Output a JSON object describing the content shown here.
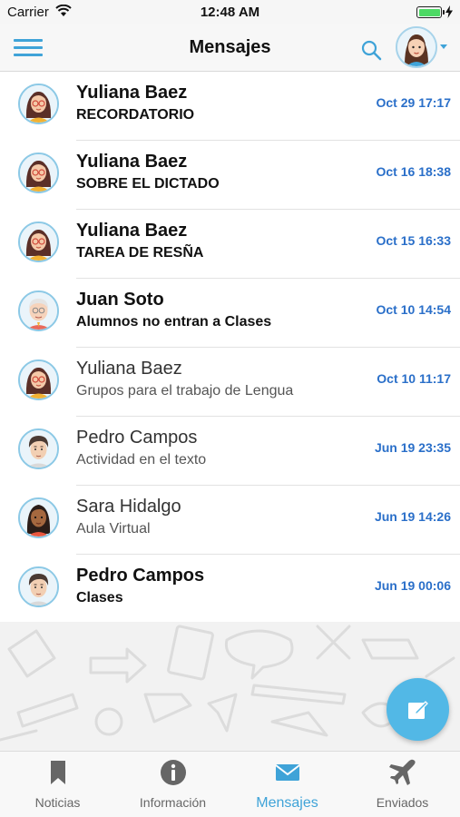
{
  "status_bar": {
    "carrier": "Carrier",
    "time": "12:48 AM"
  },
  "navbar": {
    "title": "Mensajes",
    "menu_icon": "hamburger-menu-icon",
    "search_icon": "search-icon"
  },
  "messages": [
    {
      "sender": "Yuliana Baez",
      "subject": "RECORDATORIO",
      "date": "Oct 29 17:17",
      "unread": true,
      "avatar": "female-teacher-glasses"
    },
    {
      "sender": "Yuliana Baez",
      "subject": "SOBRE EL DICTADO",
      "date": "Oct 16 18:38",
      "unread": true,
      "avatar": "female-teacher-glasses"
    },
    {
      "sender": "Yuliana Baez",
      "subject": "TAREA DE RESÑA",
      "date": "Oct 15 16:33",
      "unread": true,
      "avatar": "female-teacher-glasses"
    },
    {
      "sender": "Juan Soto",
      "subject": "Alumnos no entran a Clases",
      "date": "Oct 10 14:54",
      "unread": true,
      "avatar": "elderly-man"
    },
    {
      "sender": "Yuliana Baez",
      "subject": "Grupos para el trabajo de Lengua",
      "date": "Oct 10 11:17",
      "unread": false,
      "avatar": "female-teacher-glasses"
    },
    {
      "sender": "Pedro Campos",
      "subject": "Actividad en el texto",
      "date": "Jun 19 23:35",
      "unread": false,
      "avatar": "young-man"
    },
    {
      "sender": "Sara Hidalgo",
      "subject": "Aula Virtual",
      "date": "Jun 19 14:26",
      "unread": false,
      "avatar": "dark-skin-woman"
    },
    {
      "sender": "Pedro Campos",
      "subject": "Clases",
      "date": "Jun 19 00:06",
      "unread": true,
      "avatar": "young-man"
    }
  ],
  "tabs": [
    {
      "label": "Noticias",
      "icon": "bookmark-icon",
      "active": false
    },
    {
      "label": "Información",
      "icon": "info-icon",
      "active": false
    },
    {
      "label": "Mensajes",
      "icon": "envelope-icon",
      "active": true
    },
    {
      "label": "Enviados",
      "icon": "airplane-icon",
      "active": false
    }
  ],
  "colors": {
    "accent": "#3fa3d8",
    "date_blue": "#2a6fc9",
    "fab": "#52b8e6"
  }
}
